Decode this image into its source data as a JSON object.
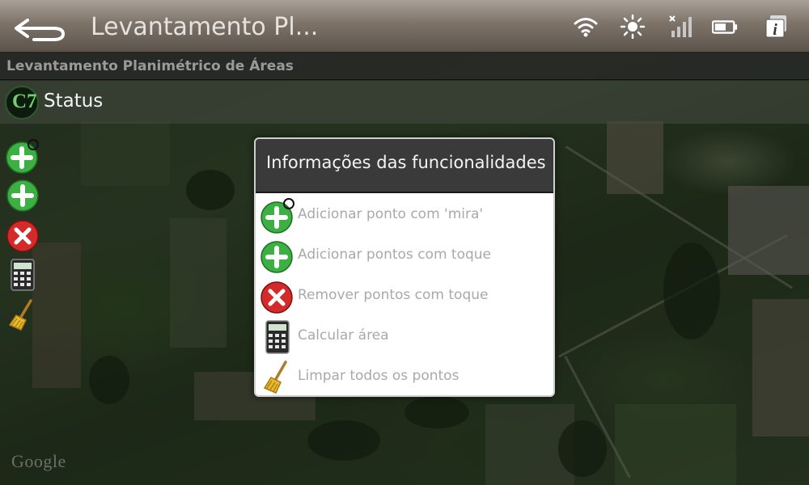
{
  "status_bar": {
    "title": "Levantamento Pl...",
    "icons": [
      "back-arrow-icon",
      "wifi-icon",
      "brightness-icon",
      "no-signal-icon",
      "battery-icon",
      "info-icon"
    ]
  },
  "title_bar": {
    "text": "Levantamento Planimétrico de Áreas"
  },
  "status_row": {
    "logo_text": "C7",
    "label": "Status"
  },
  "toolbar": {
    "tools": [
      "add-point-crosshair-icon",
      "add-point-touch-icon",
      "remove-point-icon",
      "calculator-icon",
      "broom-icon"
    ]
  },
  "dialog": {
    "title": "Informações das funcionalidades",
    "items": [
      {
        "icon": "add-point-crosshair-icon",
        "label": "Adicionar ponto com 'mira'"
      },
      {
        "icon": "add-point-touch-icon",
        "label": "Adicionar pontos com toque"
      },
      {
        "icon": "remove-point-icon",
        "label": "Remover pontos com toque"
      },
      {
        "icon": "calculator-icon",
        "label": "Calcular área"
      },
      {
        "icon": "broom-icon",
        "label": "Limpar todos os pontos"
      }
    ]
  },
  "map": {
    "attribution": "Google"
  },
  "colors": {
    "add_green": "#3cb043",
    "remove_red": "#d42a2a",
    "dialog_header": "#3a3a3a",
    "item_text": "#a9a9a9"
  }
}
